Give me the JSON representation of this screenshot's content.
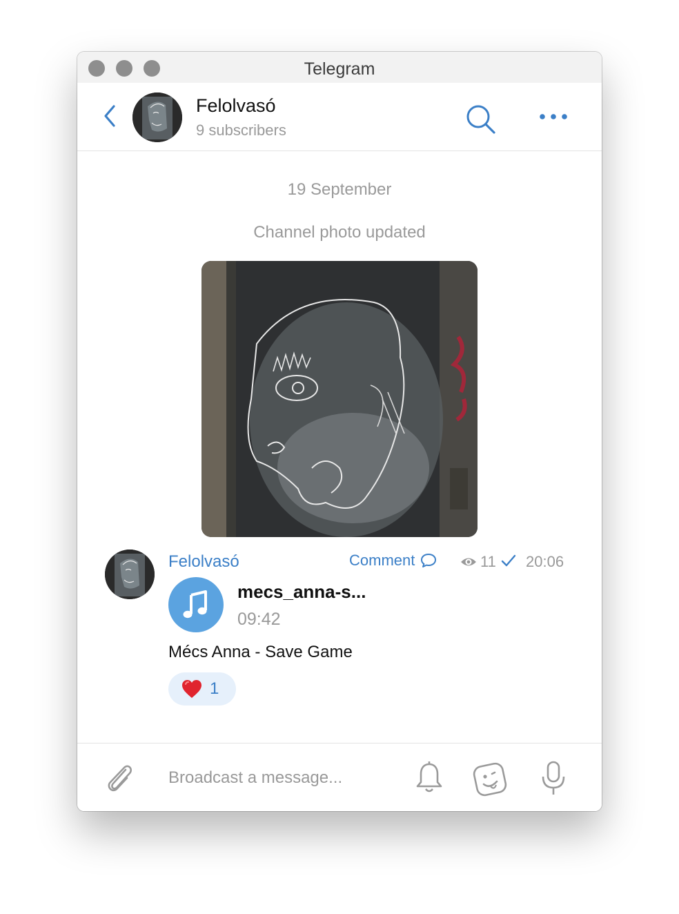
{
  "window": {
    "title": "Telegram"
  },
  "header": {
    "channel_name": "Felolvasó",
    "subscribers": "9 subscribers",
    "icons": [
      "back-chevron-icon",
      "search-icon",
      "more-dots-icon"
    ]
  },
  "chat": {
    "date_separator": "19 September",
    "service_message": "Channel photo updated",
    "message": {
      "sender": "Felolvasó",
      "comment_label": "Comment",
      "views": "11",
      "time": "20:06",
      "audio": {
        "file_name": "mecs_anna-s...",
        "duration": "09:42"
      },
      "caption": "Mécs Anna - Save Game",
      "reaction": {
        "emoji": "❤️",
        "count": "1"
      }
    }
  },
  "composer": {
    "placeholder": "Broadcast a message...",
    "icons": [
      "paperclip-icon",
      "bell-icon",
      "sticker-icon",
      "microphone-icon"
    ]
  },
  "colors": {
    "accent": "#3b7fc7",
    "play_button": "#5ba3e0",
    "reaction_bg": "#e6f0fb",
    "secondary_text": "#999999"
  }
}
